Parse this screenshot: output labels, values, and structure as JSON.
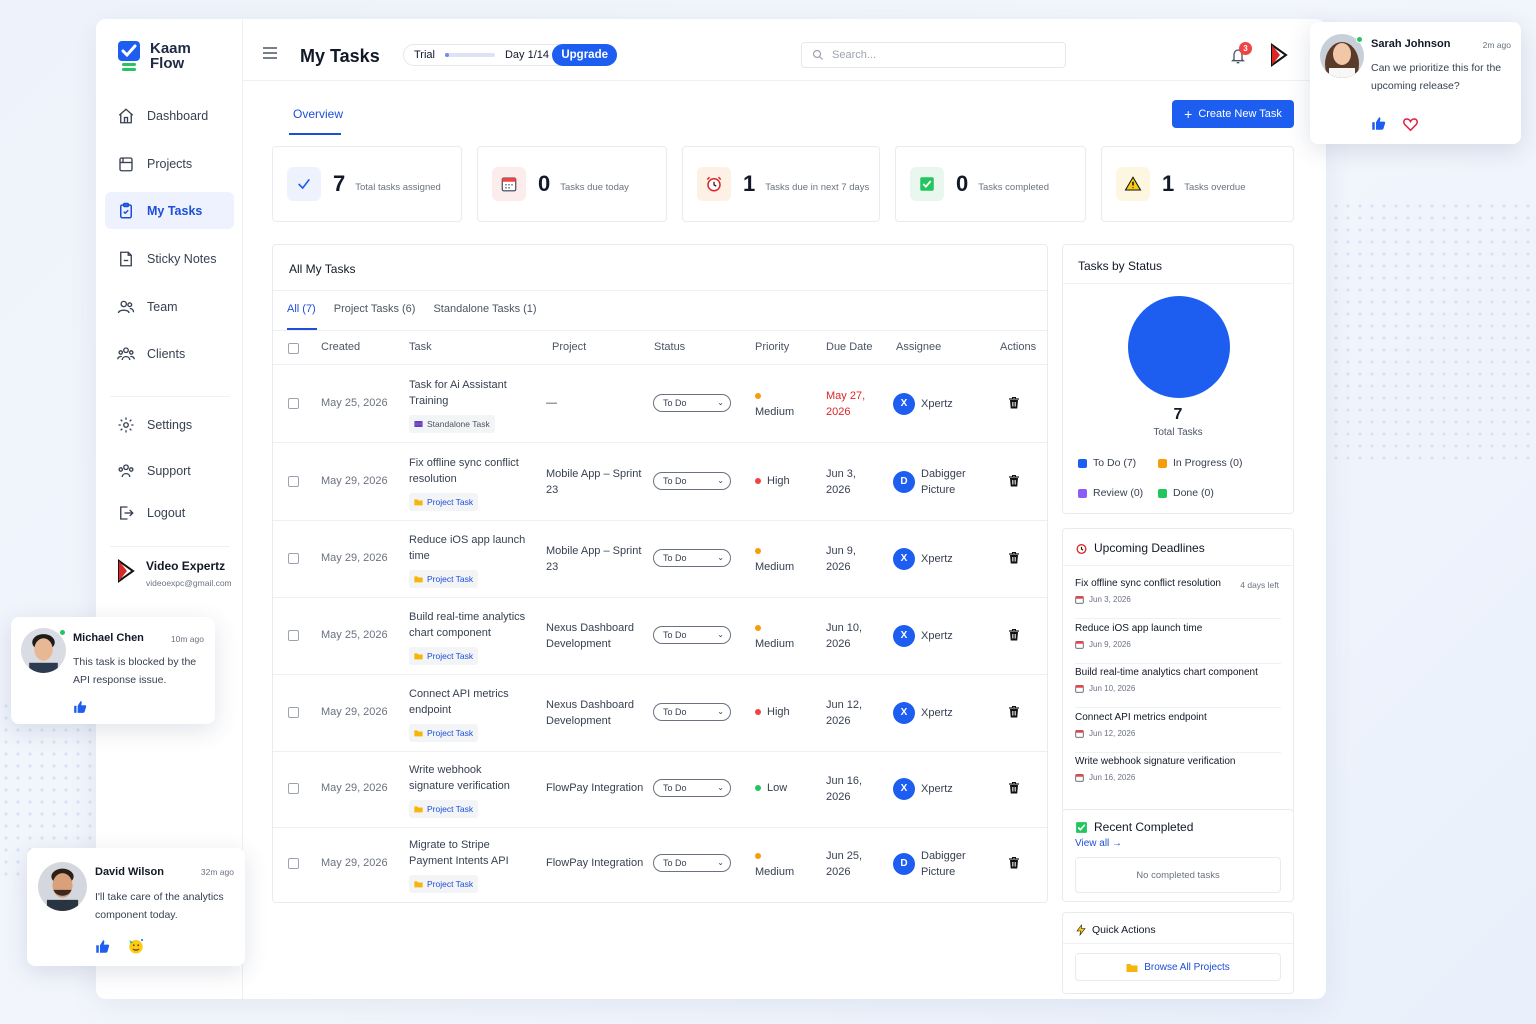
{
  "app": {
    "name_line1": "Kaam",
    "name_line2": "Flow",
    "page_title": "My Tasks"
  },
  "sidebar": {
    "items": [
      {
        "label": "Dashboard",
        "icon": "home-icon"
      },
      {
        "label": "Projects",
        "icon": "folder-icon"
      },
      {
        "label": "My Tasks",
        "icon": "clipboard-check-icon",
        "active": true
      },
      {
        "label": "Sticky Notes",
        "icon": "note-icon"
      },
      {
        "label": "Team",
        "icon": "users-icon"
      },
      {
        "label": "Clients",
        "icon": "clients-icon"
      }
    ],
    "bottom_items": [
      {
        "label": "Settings",
        "icon": "gear-icon"
      },
      {
        "label": "Support",
        "icon": "support-icon"
      },
      {
        "label": "Logout",
        "icon": "logout-icon"
      }
    ],
    "user": {
      "name": "Video Expertz",
      "email": "videoexpc@gmail.com"
    }
  },
  "topbar": {
    "trial_label": "Trial",
    "trial_progress": 0.0714,
    "trial_day": "Day 1/14",
    "upgrade_label": "Upgrade",
    "search_placeholder": "Search...",
    "notification_count": "3"
  },
  "overview_tab": "Overview",
  "create_button": "Create New Task",
  "stats": [
    {
      "value": "7",
      "label": "Total tasks assigned",
      "icon": "check-icon"
    },
    {
      "value": "0",
      "label": "Tasks due today",
      "icon": "calendar-icon"
    },
    {
      "value": "1",
      "label": "Tasks due in next 7 days",
      "icon": "alarm-clock-icon"
    },
    {
      "value": "0",
      "label": "Tasks completed",
      "icon": "checkbox-icon"
    },
    {
      "value": "1",
      "label": "Tasks overdue",
      "icon": "warning-icon"
    }
  ],
  "tasks_panel": {
    "title": "All My Tasks",
    "tabs": [
      "All (7)",
      "Project Tasks (6)",
      "Standalone Tasks (1)"
    ],
    "columns": [
      "Created",
      "Task",
      "Project",
      "Status",
      "Priority",
      "Due Date",
      "Assignee",
      "Actions"
    ],
    "rows": [
      {
        "created": "May 25, 2026",
        "task": "Task for Ai Assistant Training",
        "tag": "Standalone Task",
        "project": "—",
        "status": "To Do",
        "priority": "Medium",
        "due": "May 27, 2026",
        "overdue": true,
        "assignee": "Xpertz",
        "initial": "X"
      },
      {
        "created": "May 29, 2026",
        "task": "Fix offline sync conflict resolution",
        "tag": "Project Task",
        "project": "Mobile App – Sprint 23",
        "status": "To Do",
        "priority": "High",
        "due": "Jun 3, 2026",
        "overdue": false,
        "assignee": "Dabigger Picture",
        "initial": "D"
      },
      {
        "created": "May 29, 2026",
        "task": "Reduce iOS app launch time",
        "tag": "Project Task",
        "project": "Mobile App – Sprint 23",
        "status": "To Do",
        "priority": "Medium",
        "due": "Jun 9, 2026",
        "overdue": false,
        "assignee": "Xpertz",
        "initial": "X"
      },
      {
        "created": "May 25, 2026",
        "task": "Build real-time analytics chart component",
        "tag": "Project Task",
        "project": "Nexus Dashboard Development",
        "status": "To Do",
        "priority": "Medium",
        "due": "Jun 10, 2026",
        "overdue": false,
        "assignee": "Xpertz",
        "initial": "X"
      },
      {
        "created": "May 29, 2026",
        "task": "Connect API metrics endpoint",
        "tag": "Project Task",
        "project": "Nexus Dashboard Development",
        "status": "To Do",
        "priority": "High",
        "due": "Jun 12, 2026",
        "overdue": false,
        "assignee": "Xpertz",
        "initial": "X"
      },
      {
        "created": "May 29, 2026",
        "task": "Write webhook signature verification",
        "tag": "Project Task",
        "project": "FlowPay Integration",
        "status": "To Do",
        "priority": "Low",
        "due": "Jun 16, 2026",
        "overdue": false,
        "assignee": "Xpertz",
        "initial": "X"
      },
      {
        "created": "May 29, 2026",
        "task": "Migrate to Stripe Payment Intents API",
        "tag": "Project Task",
        "project": "FlowPay Integration",
        "status": "To Do",
        "priority": "Medium",
        "due": "Jun 25, 2026",
        "overdue": false,
        "assignee": "Dabigger Picture",
        "initial": "D"
      }
    ]
  },
  "priority_colors": {
    "High": "#ef4444",
    "Medium": "#f59e0b",
    "Low": "#22c55e"
  },
  "status_panel": {
    "title": "Tasks by Status",
    "total": "7",
    "total_label": "Total Tasks",
    "legend": [
      {
        "label": "To Do (7)",
        "color": "#1d5ef0"
      },
      {
        "label": "In Progress (0)",
        "color": "#f59e0b"
      },
      {
        "label": "Review (0)",
        "color": "#8b5cf6"
      },
      {
        "label": "Done (0)",
        "color": "#22c55e"
      }
    ]
  },
  "deadlines": {
    "title": "Upcoming Deadlines",
    "items": [
      {
        "title": "Fix offline sync conflict resolution",
        "date": "Jun 3, 2026",
        "left": "4 days left"
      },
      {
        "title": "Reduce iOS app launch time",
        "date": "Jun 9, 2026",
        "left": ""
      },
      {
        "title": "Build real-time analytics chart component",
        "date": "Jun 10, 2026",
        "left": ""
      },
      {
        "title": "Connect API metrics endpoint",
        "date": "Jun 12, 2026",
        "left": ""
      },
      {
        "title": "Write webhook signature verification",
        "date": "Jun 16, 2026",
        "left": ""
      }
    ]
  },
  "recent": {
    "title": "Recent Completed",
    "view_all": "View all →",
    "empty": "No completed tasks"
  },
  "quick": {
    "title": "Quick Actions",
    "browse": "Browse All Projects"
  },
  "comments": [
    {
      "name": "Sarah Johnson",
      "time": "2m ago",
      "message": "Can we prioritize this for the upcoming release?"
    },
    {
      "name": "Michael Chen",
      "time": "10m ago",
      "message": "This task is blocked by the API response issue."
    },
    {
      "name": "David Wilson",
      "time": "32m ago",
      "message": "I'll take care of the analytics component today."
    }
  ]
}
